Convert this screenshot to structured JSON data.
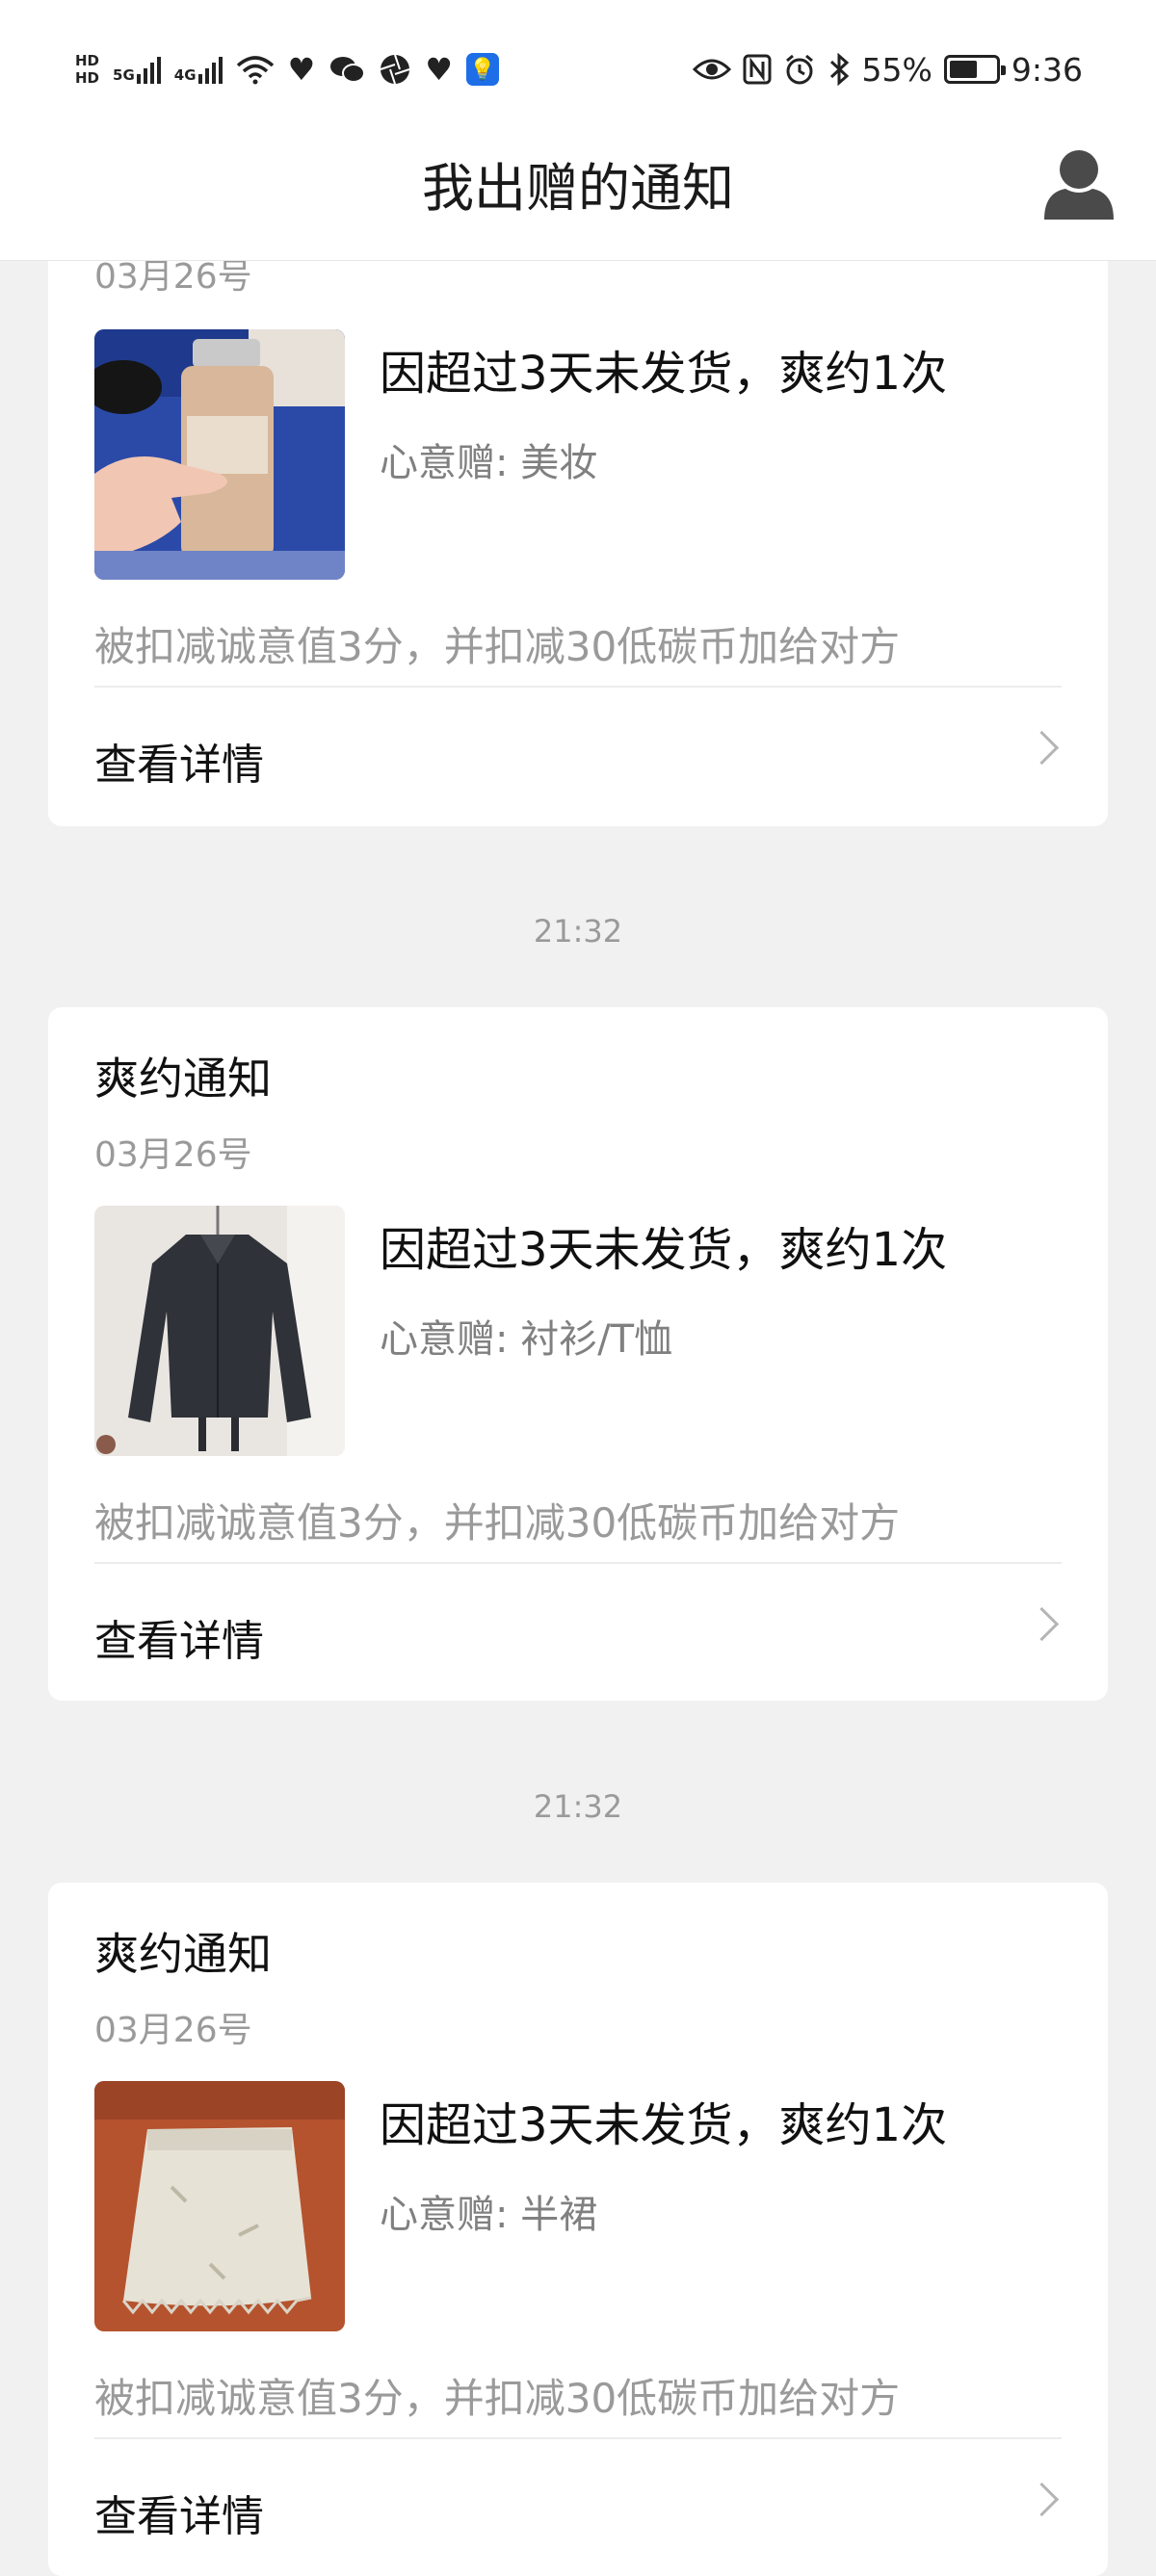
{
  "status_bar": {
    "hd_top": "HD",
    "hd_bottom": "HD",
    "net1": "5G",
    "net2": "4G",
    "battery_percent": "55%",
    "battery_level": 0.55,
    "time": "9:36",
    "icons": [
      "wifi-icon",
      "heart-icon",
      "wechat-icon",
      "aperture-icon",
      "heart-icon",
      "lightbulb-icon",
      "eye-icon",
      "nfc-icon",
      "alarm-icon",
      "bluetooth-icon",
      "battery-icon"
    ]
  },
  "header": {
    "title": "我出赠的通知"
  },
  "cards": [
    {
      "title": "",
      "date": "03月26号",
      "reason": "因超过3天未发货，爽约1次",
      "gift": "心意赠: 美妆",
      "deduction": "被扣减诚意值3分，并扣减30低碳币加给对方",
      "detail_label": "查看详情"
    },
    {
      "timestamp": "21:32",
      "title": "爽约通知",
      "date": "03月26号",
      "reason": "因超过3天未发货，爽约1次",
      "gift": "心意赠: 衬衫/T恤",
      "deduction": "被扣减诚意值3分，并扣减30低碳币加给对方",
      "detail_label": "查看详情"
    },
    {
      "timestamp": "21:32",
      "title": "爽约通知",
      "date": "03月26号",
      "reason": "因超过3天未发货，爽约1次",
      "gift": "心意赠: 半裙",
      "deduction": "被扣减诚意值3分，并扣减30低碳币加给对方",
      "detail_label": "查看详情"
    }
  ]
}
